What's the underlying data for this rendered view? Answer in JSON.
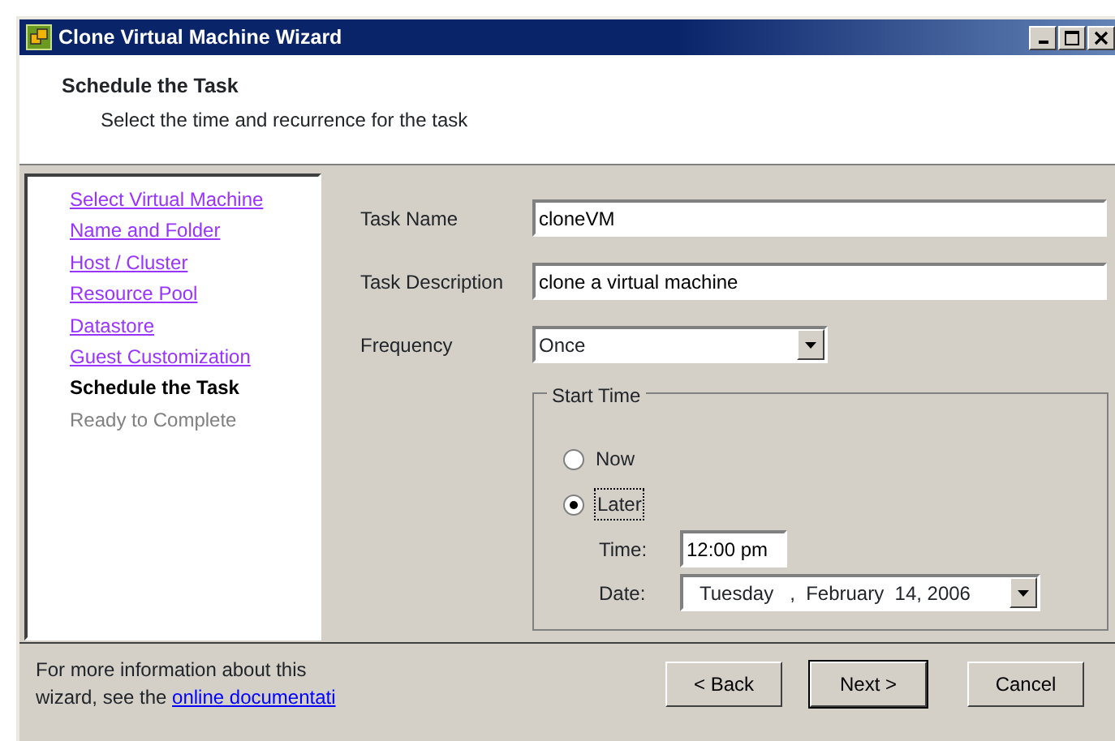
{
  "window": {
    "title": "Clone Virtual Machine Wizard"
  },
  "header": {
    "title": "Schedule the Task",
    "subtitle": "Select the time and recurrence for the task"
  },
  "steps": [
    {
      "label": "Select Virtual Machine",
      "kind": "link"
    },
    {
      "label": "Name and Folder",
      "kind": "link"
    },
    {
      "label": "Host / Cluster",
      "kind": "link"
    },
    {
      "label": "Resource Pool",
      "kind": "link"
    },
    {
      "label": "Datastore",
      "kind": "link"
    },
    {
      "label": "Guest Customization",
      "kind": "link"
    },
    {
      "label": "Schedule the Task",
      "kind": "current"
    },
    {
      "label": "Ready to Complete",
      "kind": "disabled"
    }
  ],
  "form": {
    "task_name": {
      "label": "Task Name",
      "value": "cloneVM"
    },
    "task_description": {
      "label": "Task Description",
      "value": "clone a virtual machine"
    },
    "frequency": {
      "label": "Frequency",
      "value": "Once"
    }
  },
  "start_time": {
    "title": "Start Time",
    "options": [
      {
        "label": "Now",
        "selected": false
      },
      {
        "label": "Later",
        "selected": true
      }
    ],
    "time": {
      "label": "Time:",
      "value": "12:00 pm"
    },
    "date": {
      "label": "Date:",
      "value": "Tuesday   ,  February  14, 2006"
    }
  },
  "footer": {
    "info": "For more information about this wizard,  see the",
    "link": "online documentati",
    "buttons": [
      {
        "label": "< Back",
        "default": false
      },
      {
        "label": "Next >",
        "default": true
      },
      {
        "label": "Cancel",
        "default": false
      }
    ]
  }
}
